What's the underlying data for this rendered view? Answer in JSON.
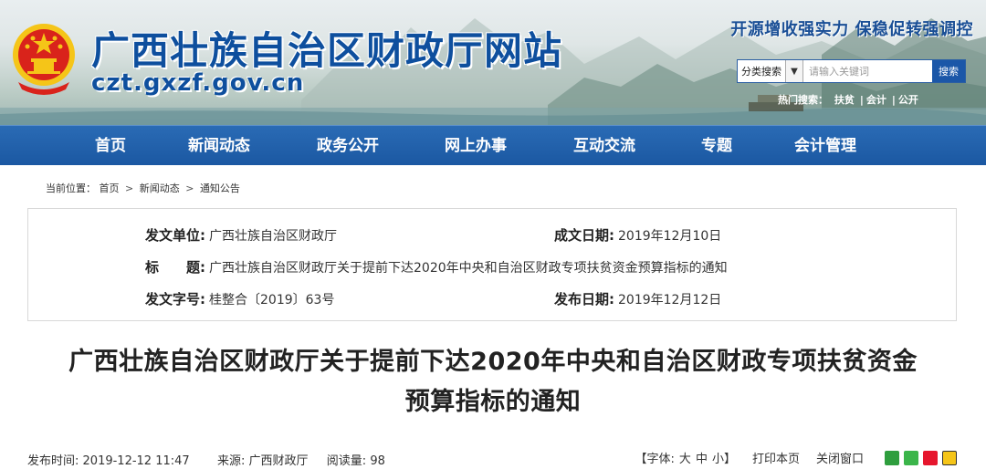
{
  "header": {
    "site_title": "广西壮族自治区财政厅网站",
    "site_domain": "czt.gxzf.gov.cn",
    "slogan": "开源增收强实力 保稳促转强调控",
    "search": {
      "category": "分类搜索",
      "placeholder": "请输入关键词",
      "button": "搜索"
    },
    "hot_words": {
      "label": "热门搜索：",
      "items": [
        "扶贫",
        "会计",
        "公开"
      ]
    }
  },
  "nav": {
    "items": [
      "首页",
      "新闻动态",
      "政务公开",
      "网上办事",
      "互动交流",
      "专题",
      "会计管理"
    ]
  },
  "breadcrumb": {
    "label": "当前位置：",
    "items": [
      "首页",
      "新闻动态",
      "通知公告"
    ],
    "separator": ">"
  },
  "info": {
    "issuer_label": "发文单位:",
    "issuer": "广西壮族自治区财政厅",
    "created_label": "成文日期:",
    "created": "2019年12月10日",
    "title_label": "标　　题:",
    "title": "广西壮族自治区财政厅关于提前下达2020年中央和自治区财政专项扶贫资金预算指标的通知",
    "doc_no_label": "发文字号:",
    "doc_no": "桂整合〔2019〕63号",
    "published_label": "发布日期:",
    "published": "2019年12月12日"
  },
  "article": {
    "title_line1": "广西壮族自治区财政厅关于提前下达2020年中央和自治区财政专项扶贫资金",
    "title_line2": "预算指标的通知"
  },
  "meta": {
    "publish_time_label": "发布时间:",
    "publish_time": "2019-12-12 11:47",
    "source_label": "来源:",
    "source": "广西财政厅",
    "views_label": "阅读量:",
    "views": "98"
  },
  "tools": {
    "font_label": "【字体:",
    "font_large": "大",
    "font_medium": "中",
    "font_small": "小】",
    "print": "打印本页",
    "close": "关闭窗口"
  },
  "colors": {
    "nav_bg": "#1b58a2",
    "title_blue": "#0e4f9e",
    "emblem_red": "#d9231b",
    "emblem_gold": "#f5c518"
  }
}
